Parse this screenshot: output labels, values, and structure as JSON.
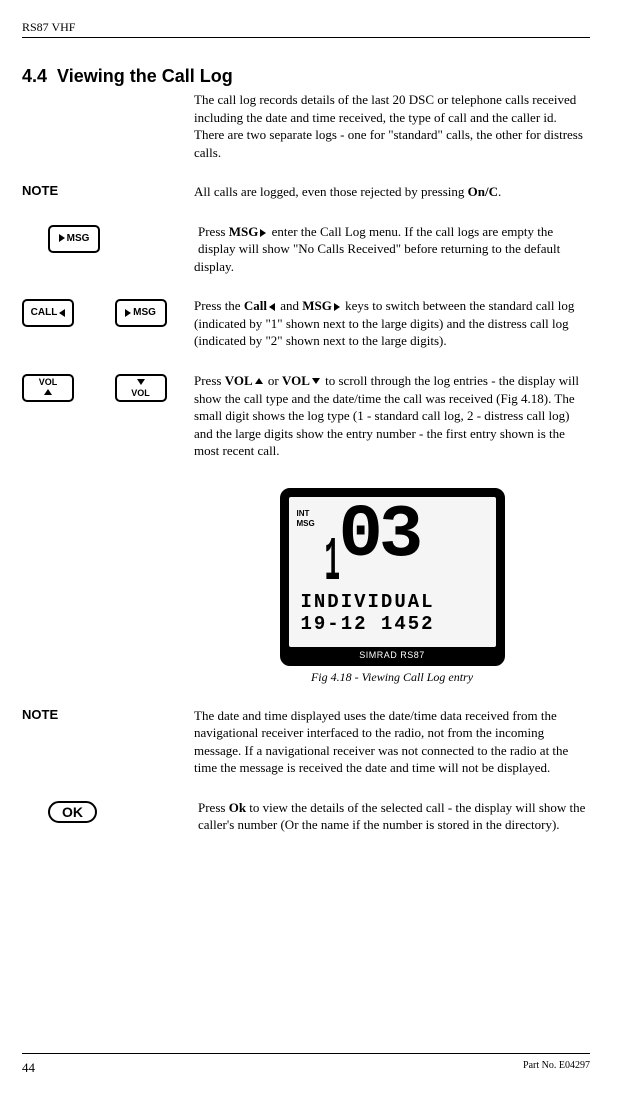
{
  "header": {
    "product": "RS87 VHF"
  },
  "section": {
    "number": "4.4",
    "title": "Viewing the Call Log"
  },
  "body": {
    "intro": "The call log records details of the last 20 DSC or telephone calls received including the date and time received, the type of call and the caller id.  There are two separate logs - one for \"standard\" calls, the other for distress calls.",
    "note1_label": "NOTE",
    "note1_text_a": "All calls are logged, even those rejected by pressing ",
    "note1_bold": "On/C",
    "note1_text_b": ".",
    "msg_para_a": "Press ",
    "msg_bold": "MSG",
    "msg_para_b": " enter the Call Log menu.  If the call logs are empty the display will show \"No Calls Received\" before returning to the default display.",
    "callmsg_para_a": "Press the ",
    "call_bold": "Call",
    "callmsg_para_b": " and ",
    "msg2_bold": "MSG",
    "callmsg_para_c": " keys to switch between the standard call log (indicated by \"1\" shown next to the large digits) and the distress call log (indicated by \"2\" shown next to the large digits).",
    "vol_para_a": "Press ",
    "vol_bold1": "VOL",
    "vol_para_b": " or ",
    "vol_bold2": "VOL",
    "vol_para_c": " to scroll through the log entries - the display will show the call type and the date/time the call was received (Fig 4.18).  The small digit shows the log type (1 - standard call log, 2 - distress call log) and the large digits show the entry number - the first entry shown is the most recent call.",
    "fig_caption": "Fig 4.18 - Viewing Call Log entry",
    "note2_label": "NOTE",
    "note2_text": "The date and time displayed uses the date/time data received from the navigational receiver interfaced to the radio, not from the incoming message.  If a navigational receiver was not connected to the radio at the time the message is received the date and time will not be displayed.",
    "ok_para_a": "Press ",
    "ok_bold": "Ok",
    "ok_para_b": " to view the details of the selected call - the display will show the caller's number (Or the name if the number is stored in the directory)."
  },
  "buttons": {
    "msg": "MSG",
    "call": "CALL",
    "vol": "VOL",
    "ok": "OK"
  },
  "lcd": {
    "flags": "INT\nMSG",
    "small_digit": "1",
    "big_digits": "03",
    "line1": "INDIVIDUAL",
    "line2": "19-12 1452",
    "brand": "SIMRAD RS87"
  },
  "footer": {
    "page": "44",
    "part": "Part No. E04297"
  }
}
